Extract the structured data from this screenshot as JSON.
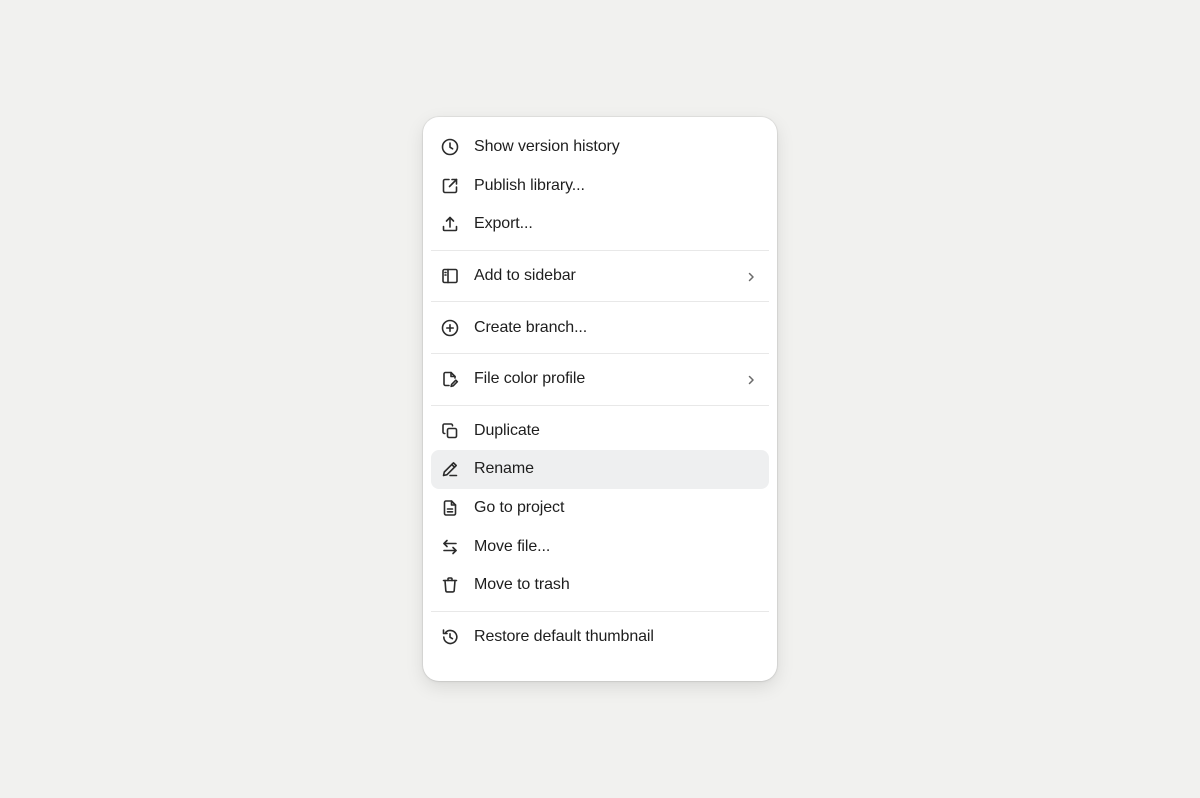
{
  "menu": {
    "items": [
      {
        "label": "Show version history",
        "icon": "clock-icon"
      },
      {
        "label": "Publish library...",
        "icon": "external-link-icon"
      },
      {
        "label": "Export...",
        "icon": "upload-icon"
      },
      {
        "label": "Add to sidebar",
        "icon": "sidebar-icon",
        "submenu": true
      },
      {
        "label": "Create branch...",
        "icon": "plus-circle-icon"
      },
      {
        "label": "File color profile",
        "icon": "file-edit-icon",
        "submenu": true
      },
      {
        "label": "Duplicate",
        "icon": "copy-icon"
      },
      {
        "label": "Rename",
        "icon": "pencil-icon",
        "highlighted": true
      },
      {
        "label": "Go to project",
        "icon": "file-text-icon"
      },
      {
        "label": "Move file...",
        "icon": "arrows-swap-icon"
      },
      {
        "label": "Move to trash",
        "icon": "trash-icon"
      },
      {
        "label": "Restore default thumbnail",
        "icon": "history-icon"
      }
    ]
  },
  "colors": {
    "background": "#f1f1ef",
    "menu": "#ffffff",
    "highlight": "#eeeff0",
    "text": "#1e1e1e"
  }
}
